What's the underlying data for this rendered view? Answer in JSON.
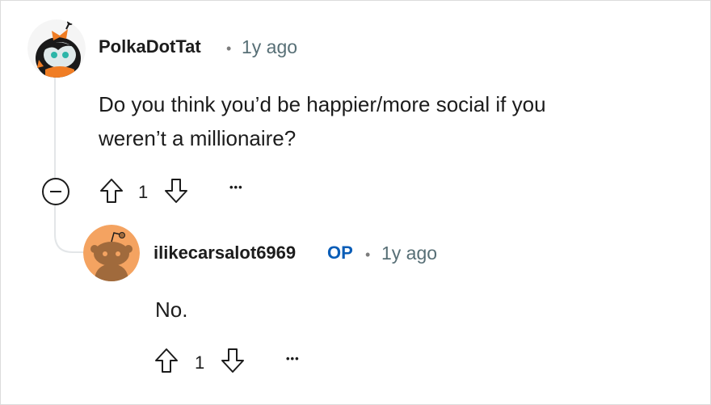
{
  "comments": [
    {
      "username": "PolkaDotTat",
      "separator": "•",
      "time": "1y ago",
      "body_line1": "Do you think you’d be happier/more social if you",
      "body_line2": "weren’t a millionaire?",
      "votes": "1",
      "more": "•••",
      "avatar_icon": "snoo-avatar-icon"
    },
    {
      "username": "ilikecarsalot6969",
      "op_badge": "OP",
      "separator": "•",
      "time": "1y ago",
      "body": "No.",
      "votes": "1",
      "more": "•••",
      "avatar_icon": "default-snoo-avatar-icon"
    }
  ],
  "colors": {
    "op_blue": "#0a5db7",
    "meta_gray": "#576f76",
    "thread_line": "#e3e6e8",
    "default_avatar_bg": "#f4a361"
  }
}
